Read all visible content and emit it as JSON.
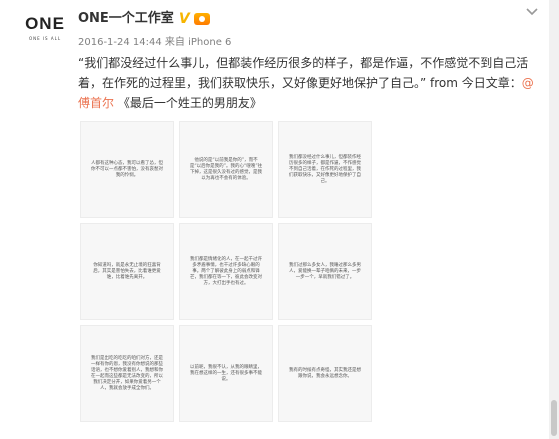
{
  "avatar": {
    "logo": "ONE",
    "tagline": "ONE IS ALL"
  },
  "post": {
    "username": "ONE一个工作室",
    "verified_badge": "V",
    "meta": "2016-1-24 14:44 来自 iPhone 6",
    "text_before_link": "“我们都没经过什么事儿，但都装作经历很多的样子，都是作逼，不作感觉不到自己活着，在作死的过程里，我们获取快乐，又好像更好地保护了自己。” from 今日文章：",
    "link_text": "@傅首尔",
    "text_after_link": " 《最后一个姓王的男朋友》"
  },
  "images": [
    "人都有这种心态，我可以看了怂，但你不可以一点都不害怕，没有哀愁对我的怜悯。",
    "他说的是“以前我是你的”，而不是“以后你是我的”。我的心“嗖嗖”往下掉，这是很久没有过的感觉，是我以为再也不会有的体验。",
    "我们都没经过什么事儿，但都装作经历很多的样子，都是作逼，不作感觉不到自己活着，在作死的过程里，我们获取快乐，又好像更好地保护了自己。",
    "你知道吗，就是永无止境的狂喜背后，其实是害怕失去，比着谁更爱谁，比着谁先离开。",
    "我们都是情绪化的人，在一起千过许多矛盾事情，也干过许多缺心眼的事。两个了解彼此身上的弱点和锋芒，我们都在等一下，彼此会改变对方，大打出手也有过。",
    "我们过那么多女人，我睡过那么多男人，爱能换一辈子咱俩的未来，一步一步一个，早就我们错过了。",
    "我们是出吃的吃吃的咱们对方，还是一样有你的恩，我没有你想说的那些话语，也不想你爱着别人，我想和你在一起而这些都是无法改变的，所以我们决定分开，如果你爱着另一个人，我就会放手成全你们。",
    "以前呢，我很不认，从我的眼睛里，我在想这样的一生，还有很多事不能说。",
    "我有的时候有点奇怪，其实我还是想跟你说，我会永远想念你。"
  ]
}
